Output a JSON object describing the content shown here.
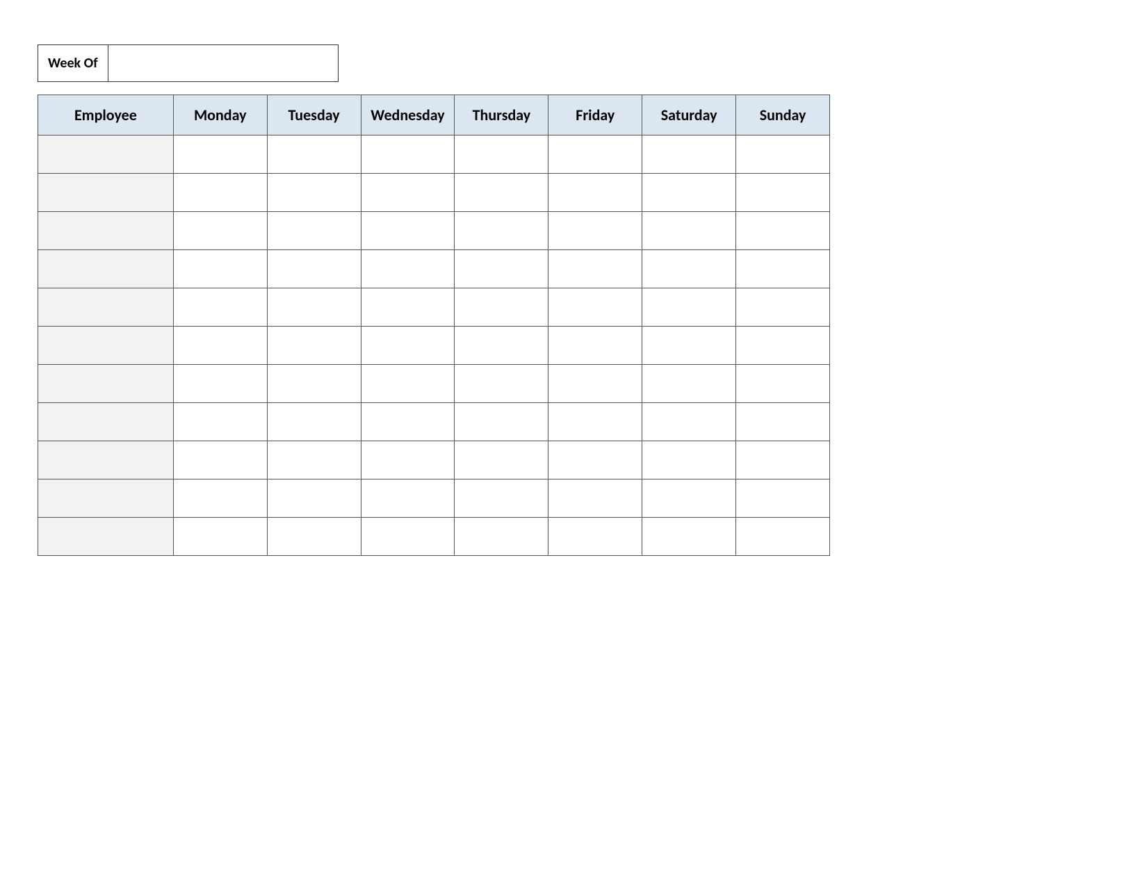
{
  "week_of": {
    "label": "Week Of",
    "value": ""
  },
  "headers": {
    "employee": "Employee",
    "days": [
      "Monday",
      "Tuesday",
      "Wednesday",
      "Thursday",
      "Friday",
      "Saturday",
      "Sunday"
    ]
  },
  "rows": [
    {
      "employee": "",
      "cells": [
        "",
        "",
        "",
        "",
        "",
        "",
        ""
      ]
    },
    {
      "employee": "",
      "cells": [
        "",
        "",
        "",
        "",
        "",
        "",
        ""
      ]
    },
    {
      "employee": "",
      "cells": [
        "",
        "",
        "",
        "",
        "",
        "",
        ""
      ]
    },
    {
      "employee": "",
      "cells": [
        "",
        "",
        "",
        "",
        "",
        "",
        ""
      ]
    },
    {
      "employee": "",
      "cells": [
        "",
        "",
        "",
        "",
        "",
        "",
        ""
      ]
    },
    {
      "employee": "",
      "cells": [
        "",
        "",
        "",
        "",
        "",
        "",
        ""
      ]
    },
    {
      "employee": "",
      "cells": [
        "",
        "",
        "",
        "",
        "",
        "",
        ""
      ]
    },
    {
      "employee": "",
      "cells": [
        "",
        "",
        "",
        "",
        "",
        "",
        ""
      ]
    },
    {
      "employee": "",
      "cells": [
        "",
        "",
        "",
        "",
        "",
        "",
        ""
      ]
    },
    {
      "employee": "",
      "cells": [
        "",
        "",
        "",
        "",
        "",
        "",
        ""
      ]
    },
    {
      "employee": "",
      "cells": [
        "",
        "",
        "",
        "",
        "",
        "",
        ""
      ]
    }
  ]
}
